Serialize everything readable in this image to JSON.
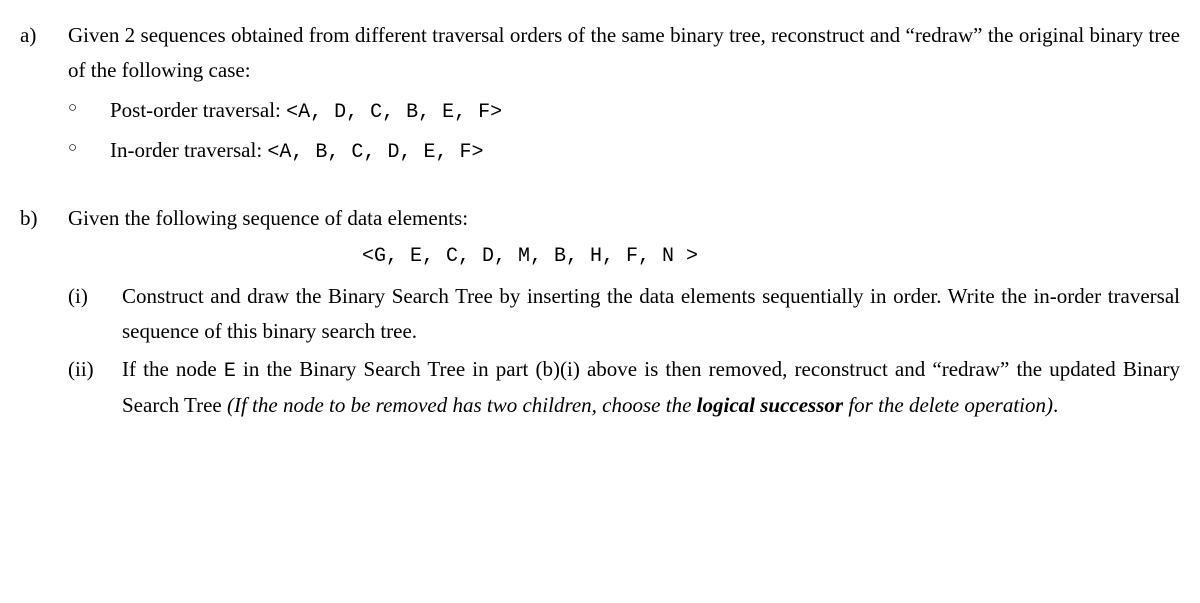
{
  "qa": {
    "label": "a)",
    "text_line1": "Given 2 sequences obtained from different traversal orders of the same binary tree, reconstruct and",
    "text_line2": "“redraw” the original binary tree of the following case:",
    "bullets": [
      {
        "prefix": "Post-order traversal: ",
        "seq": "<A, D, C, B, E, F>"
      },
      {
        "prefix": "In-order traversal: ",
        "seq": "<A, B, C, D, E, F>"
      }
    ]
  },
  "qb": {
    "label": "b)",
    "intro": "Given the following sequence of data elements:",
    "sequence": "<G, E, C, D, M, B, H, F, N >",
    "parts": {
      "i": {
        "label": "(i)",
        "text": "Construct and draw the Binary Search Tree by inserting the data elements sequentially in order. Write the in-order traversal sequence of this binary search tree."
      },
      "ii": {
        "label": "(ii)",
        "seg1": "If the node ",
        "code": "E",
        "seg2": " in the Binary Search Tree in part (b)(i) above is then removed, reconstruct and “redraw” the updated Binary Search Tree ",
        "ital1": "(If the node to be removed has two children, choose the ",
        "boldital": "logical successor",
        "ital2": " for the delete operation)",
        "period": "."
      }
    }
  }
}
